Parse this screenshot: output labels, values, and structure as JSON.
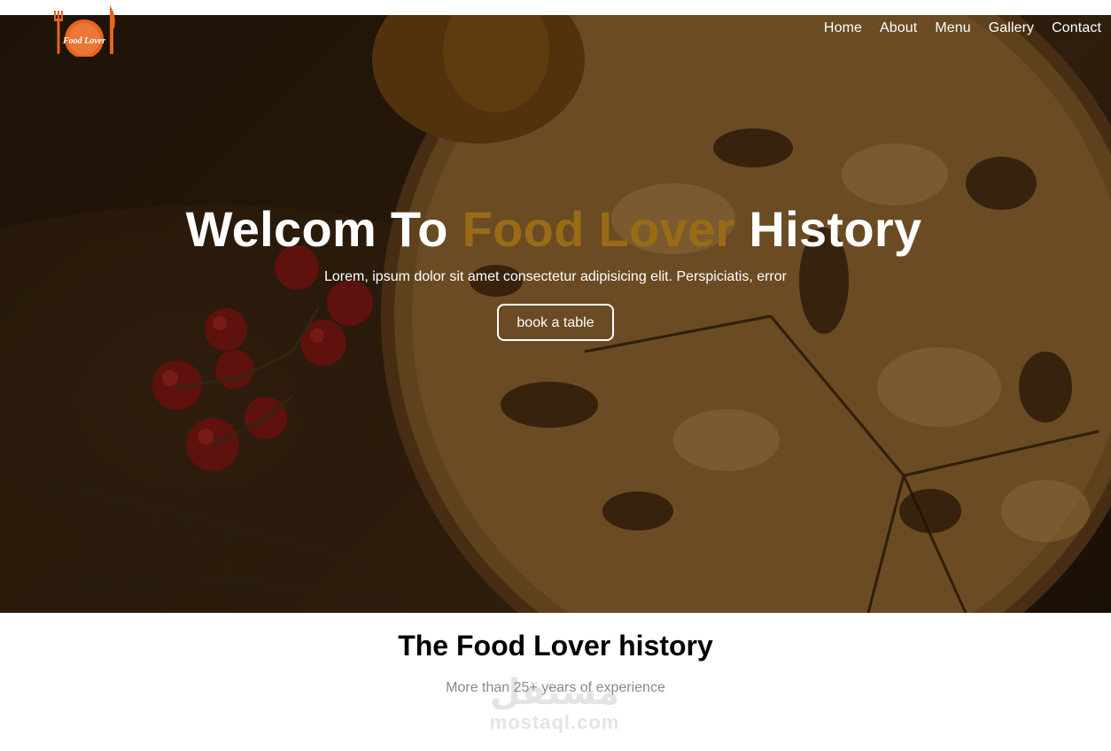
{
  "brand": {
    "logo_text": "Food Lover",
    "logo_color": "#e8641c"
  },
  "nav": {
    "items": [
      {
        "label": "Home"
      },
      {
        "label": "About"
      },
      {
        "label": "Menu"
      },
      {
        "label": "Gallery"
      },
      {
        "label": "Contact"
      }
    ]
  },
  "hero": {
    "title_start": "Welcom To",
    "title_accent": "Food Lover",
    "title_end": "History",
    "subtitle": "Lorem, ipsum dolor sit amet consectetur adipisicing elit. Perspiciatis, error",
    "button_label": "book a table",
    "accent_color": "#9a6b16"
  },
  "history": {
    "heading": "The Food Lover history",
    "subheading": "More than 25+ years of experience"
  },
  "watermark": {
    "arabic": "مستقل",
    "latin": "mostaql.com"
  }
}
